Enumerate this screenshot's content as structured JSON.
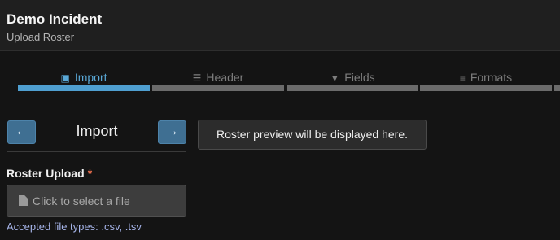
{
  "header": {
    "title": "Demo Incident",
    "subtitle": "Upload Roster"
  },
  "steps": [
    {
      "label": "Import",
      "icon": "file-icon",
      "active": true
    },
    {
      "label": "Header",
      "icon": "list-icon",
      "active": false
    },
    {
      "label": "Fields",
      "icon": "filter-icon",
      "active": false
    },
    {
      "label": "Formats",
      "icon": "sliders-icon",
      "active": false
    }
  ],
  "panel": {
    "title": "Import",
    "prev_glyph": "←",
    "next_glyph": "→"
  },
  "preview": {
    "text": "Roster preview will be displayed here."
  },
  "upload": {
    "label": "Roster Upload",
    "required_mark": "*",
    "button_text": "Click to select a file",
    "accepted_types": "Accepted file types: .csv, .tsv"
  },
  "colors": {
    "accent": "#4f9fd0",
    "required": "#e36b4b",
    "hint": "#a5b3e8"
  }
}
